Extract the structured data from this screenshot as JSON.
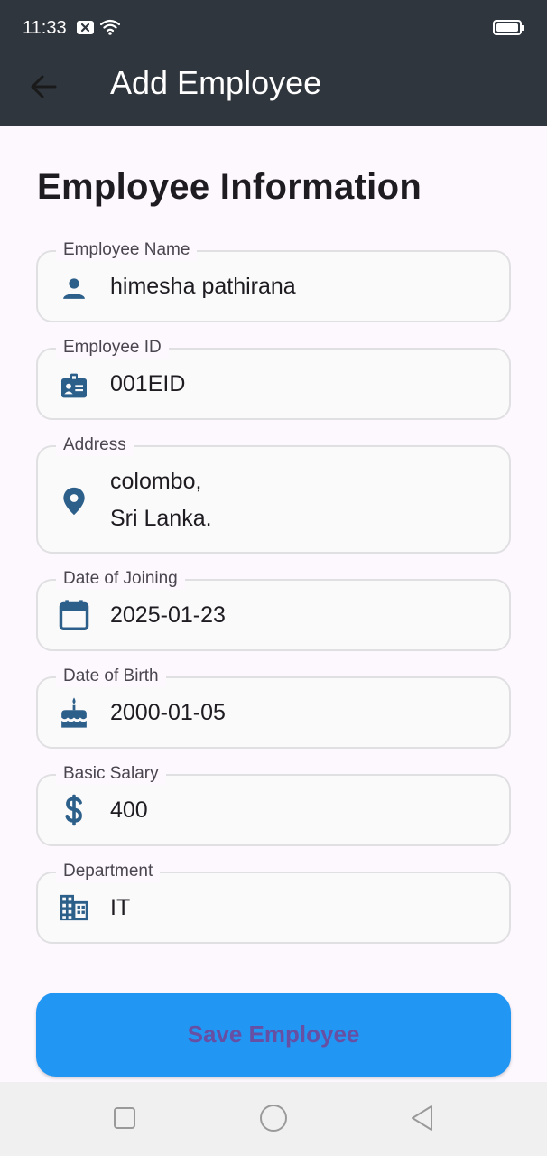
{
  "status_bar": {
    "time": "11:33"
  },
  "app_bar": {
    "title": "Add Employee",
    "back_icon": "arrow-back-icon"
  },
  "form": {
    "section_title": "Employee Information",
    "fields": [
      {
        "label": "Employee Name",
        "value": "himesha pathirana",
        "icon": "person-icon"
      },
      {
        "label": "Employee ID",
        "value": "001EID",
        "icon": "badge-icon"
      },
      {
        "label": "Address",
        "value": "colombo,\nSri Lanka.",
        "icon": "location-pin-icon"
      },
      {
        "label": "Date of Joining",
        "value": "2025-01-23",
        "icon": "calendar-icon"
      },
      {
        "label": "Date of Birth",
        "value": "2000-01-05",
        "icon": "cake-icon"
      },
      {
        "label": "Basic Salary",
        "value": "400",
        "icon": "dollar-icon"
      },
      {
        "label": "Department",
        "value": "IT",
        "icon": "building-icon"
      }
    ],
    "save_label": "Save Employee"
  },
  "colors": {
    "app_bar": "#30363d",
    "icon": "#2c5f8a",
    "button": "#2196f3",
    "button_text": "#6750a4"
  },
  "nav_bar": {
    "icons": [
      "recent-apps-icon",
      "home-icon",
      "back-triangle-icon"
    ]
  }
}
